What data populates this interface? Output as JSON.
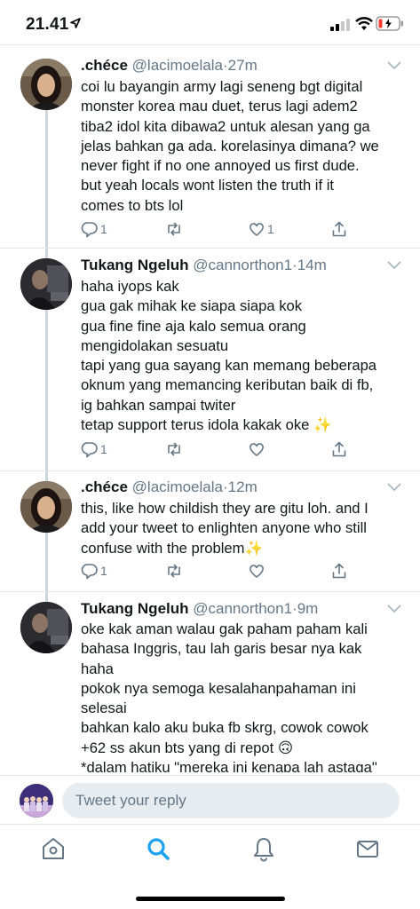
{
  "status_bar": {
    "time": "21.41"
  },
  "tweets": [
    {
      "name": ".chéce",
      "handle": "@lacimoelala",
      "dot": "·",
      "time": "27m",
      "text": "coi lu bayangin army lagi seneng bgt digital\nmonster korea mau duet, terus lagi adem2\ntiba2 idol kita dibawa2 untuk alesan yang ga\njelas bahkan ga ada. korelasinya dimana? we\nnever fight if no one annoyed us first dude.\nbut yeah locals wont listen the truth if it\ncomes to bts lol",
      "reply_count": "1",
      "retweet_count": "",
      "like_count": "1"
    },
    {
      "name": "Tukang Ngeluh",
      "handle": "@cannorthon1",
      "dot": "·",
      "time": "14m",
      "text": "haha iyops kak\ngua gak mihak ke siapa siapa kok\ngua fine fine aja kalo semua orang\nmengidolakan sesuatu\ntapi yang gua sayang kan memang beberapa\noknum yang memancing keributan baik di fb,\nig bahkan sampai twiter\ntetap support terus idola kakak oke ✨",
      "reply_count": "1",
      "retweet_count": "",
      "like_count": ""
    },
    {
      "name": ".chéce",
      "handle": "@lacimoelala",
      "dot": "·",
      "time": "12m",
      "text": "this, like how childish they are gitu loh. and I\nadd your tweet to enlighten anyone who still\nconfuse with the problem✨",
      "reply_count": "1",
      "retweet_count": "",
      "like_count": ""
    },
    {
      "name": "Tukang Ngeluh",
      "handle": "@cannorthon1",
      "dot": "·",
      "time": "9m",
      "text": "oke kak aman walau gak paham paham kali\nbahasa Inggris, tau lah garis besar nya kak\nhaha\npokok nya semoga kesalahanpahaman ini\nselesai\nbahkan kalo aku buka fb skrg, cowok cowok\n+62 ss akun bts yang di repot 🙃\n*dalam hatiku \"mereka ini kenapa lah astaga\""
    }
  ],
  "reply_bar": {
    "placeholder": "Tweet your reply"
  },
  "colors": {
    "accent": "#1da1f2",
    "secondary_text": "#657786",
    "divider": "#e1e8ed"
  },
  "tab_bar": {
    "items": [
      "home-icon",
      "search-icon",
      "notifications-icon",
      "messages-icon"
    ],
    "active": "search-icon"
  }
}
